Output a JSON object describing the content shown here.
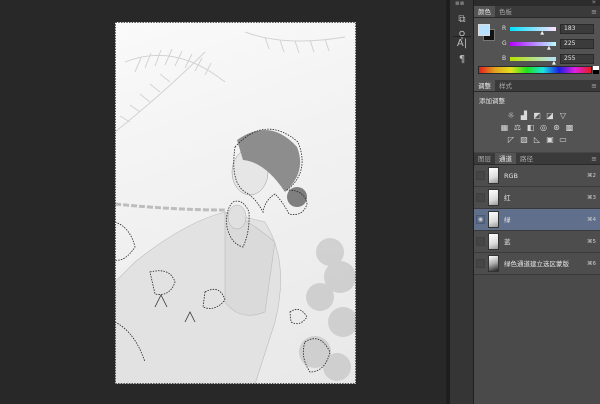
{
  "color_panel": {
    "tabs": [
      "颜色",
      "色板"
    ],
    "channels": [
      {
        "label": "R",
        "value": "183",
        "fraction": 0.72,
        "gradient": "linear-gradient(to right,#00e1ff,#ffe1ff)"
      },
      {
        "label": "G",
        "value": "225",
        "fraction": 0.88,
        "gradient": "linear-gradient(to right,#b700ff,#b7ffff)"
      },
      {
        "label": "B",
        "value": "255",
        "fraction": 1.0,
        "gradient": "linear-gradient(to right,#b7e100,#b7e1ff)"
      }
    ],
    "foreground_color": "#b7e1ff",
    "background_color": "#111111"
  },
  "adjustments_panel": {
    "tabs": [
      "调整",
      "样式"
    ],
    "title": "添加调整",
    "icon_rows": [
      [
        "brightness-icon",
        "levels-icon",
        "curves-icon",
        "exposure-icon",
        "vibrance-triangle-icon"
      ],
      [
        "hue-saturation-icon",
        "color-balance-icon",
        "black-white-icon",
        "photo-filter-icon",
        "channel-mixer-icon",
        "color-lookup-icon"
      ],
      [
        "invert-icon",
        "posterize-icon",
        "threshold-icon",
        "selective-color-icon",
        "gradient-map-icon"
      ]
    ]
  },
  "channels_panel": {
    "tabs": [
      "图层",
      "通道",
      "路径"
    ],
    "active_tab": 1,
    "channels": [
      {
        "name": "RGB",
        "shortcut": "⌘2",
        "selected": false,
        "visible": false
      },
      {
        "name": "红",
        "shortcut": "⌘3",
        "selected": false,
        "visible": false
      },
      {
        "name": "绿",
        "shortcut": "⌘4",
        "selected": true,
        "visible": true
      },
      {
        "name": "蓝",
        "shortcut": "⌘5",
        "selected": false,
        "visible": false
      },
      {
        "name": "绿色通道建立选区蒙版",
        "shortcut": "⌘6",
        "selected": false,
        "visible": false
      }
    ]
  },
  "toolstrip": {
    "icons": [
      "history-icon",
      "adjust-brush-icon",
      "character-icon",
      "paragraph-icon"
    ]
  }
}
